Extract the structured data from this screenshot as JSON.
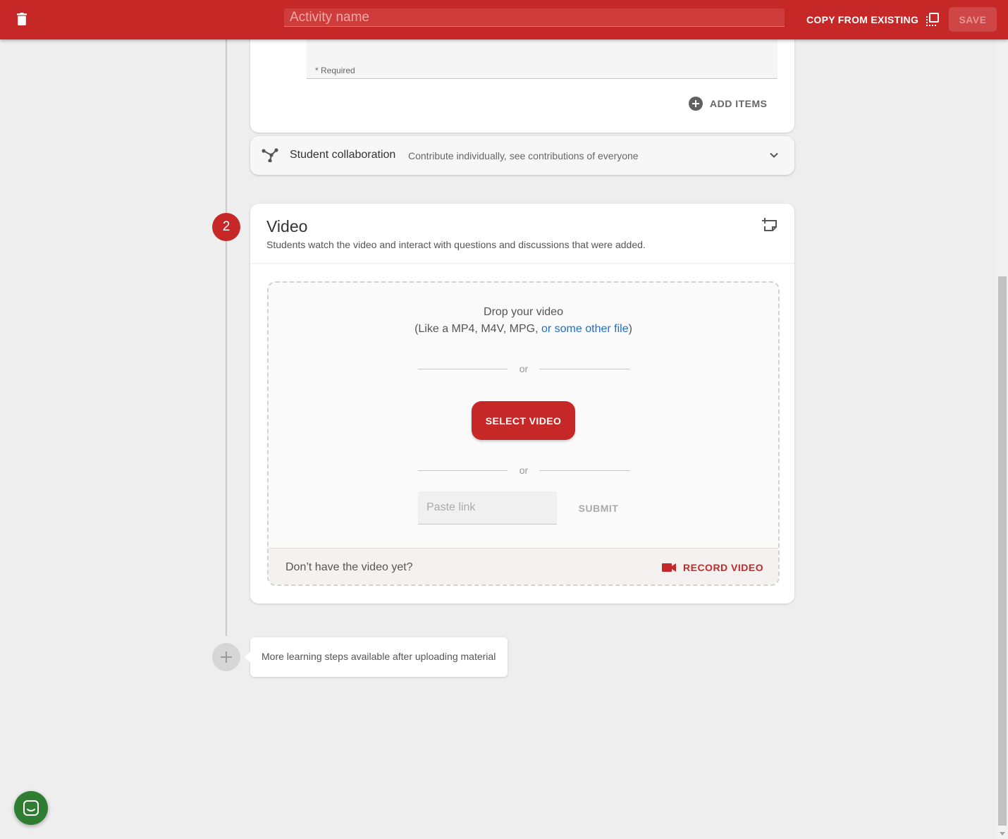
{
  "topbar": {
    "title_placeholder": "Activity name",
    "copy_label": "COPY FROM EXISTING",
    "save_label": "SAVE"
  },
  "section1": {
    "required_label": "* Required",
    "add_items_label": "ADD ITEMS"
  },
  "collaboration": {
    "title": "Student collaboration",
    "description": "Contribute individually, see contributions of everyone"
  },
  "video_step": {
    "number": "2",
    "title": "Video",
    "subtitle": "Students watch the video and interact with questions and discussions that were added.",
    "drop_title": "Drop your video",
    "drop_formats_prefix": "(Like a MP4, M4V, MPG, ",
    "drop_formats_link": "or some other file",
    "drop_formats_suffix": ")",
    "or_label": "or",
    "select_label": "SELECT VIDEO",
    "paste_placeholder": "Paste link",
    "submit_label": "SUBMIT",
    "no_video_question": "Don’t have the video yet?",
    "record_label": "RECORD VIDEO"
  },
  "more_steps": {
    "text": "More learning steps available after uploading material"
  },
  "icons": {
    "trash": "trash-icon",
    "copy": "copy-icon",
    "add_circle": "add-circle-icon",
    "share": "share-icon",
    "chevron": "chevron-down-icon",
    "add_note": "add-note-icon",
    "video_camera": "video-camera-icon",
    "plus": "plus-icon",
    "chat": "chat-icon"
  },
  "colors": {
    "primary": "#c62828",
    "link": "#1e6fc8",
    "chat": "#2e7d32",
    "background": "#eeeeee"
  }
}
